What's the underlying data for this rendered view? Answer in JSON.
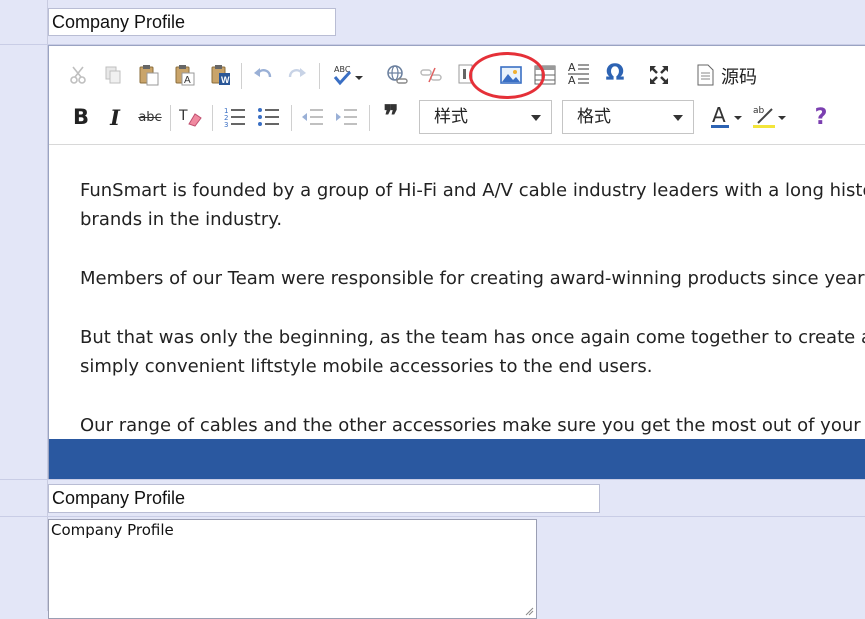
{
  "fields": {
    "title_value": "Company Profile",
    "title2_value": "Company Profile",
    "textarea_value": "Company Profile"
  },
  "toolbar": {
    "row1": [
      {
        "name": "cut-icon",
        "label": "Cut"
      },
      {
        "name": "copy-icon",
        "label": "Copy"
      },
      {
        "name": "paste-icon",
        "label": "Paste"
      },
      {
        "name": "paste-text-icon",
        "label": "Paste as plain text"
      },
      {
        "name": "paste-word-icon",
        "label": "Paste from Word"
      },
      {
        "name": "undo-icon",
        "label": "Undo"
      },
      {
        "name": "redo-icon",
        "label": "Redo"
      },
      {
        "name": "spellcheck-icon",
        "label": "Spell check"
      },
      {
        "name": "link-icon",
        "label": "Link"
      },
      {
        "name": "unlink-icon",
        "label": "Unlink"
      },
      {
        "name": "anchor-icon",
        "label": "Anchor"
      },
      {
        "name": "image-icon",
        "label": "Image"
      },
      {
        "name": "table-icon",
        "label": "Table"
      },
      {
        "name": "horizontal-rule-icon",
        "label": "Horizontal line"
      },
      {
        "name": "special-char-icon",
        "label": "Special character"
      },
      {
        "name": "maximize-icon",
        "label": "Maximize"
      },
      {
        "name": "source-icon",
        "label": "Source"
      }
    ],
    "source_label": "源码",
    "style_label": "样式",
    "format_label": "格式",
    "special_char_glyph": "Ω",
    "abc_label": "abc"
  },
  "content": {
    "paragraphs": [
      "FunSmart is founded by a group of Hi-Fi and A/V cable industry leaders with a long history",
      "brands in the industry.",
      "Members of our Team were responsible for creating award-winning products since year",
      "But that was only the beginning, as the team has once again come together to create a",
      "simply convenient liftstyle mobile accessories to the end users.",
      "Our range of cables and the other accessories make sure you get the most out of your d"
    ]
  },
  "colors": {
    "accent": "#2a58a0",
    "highlight_ring": "#e53038",
    "page_bg": "#e3e6f7"
  }
}
